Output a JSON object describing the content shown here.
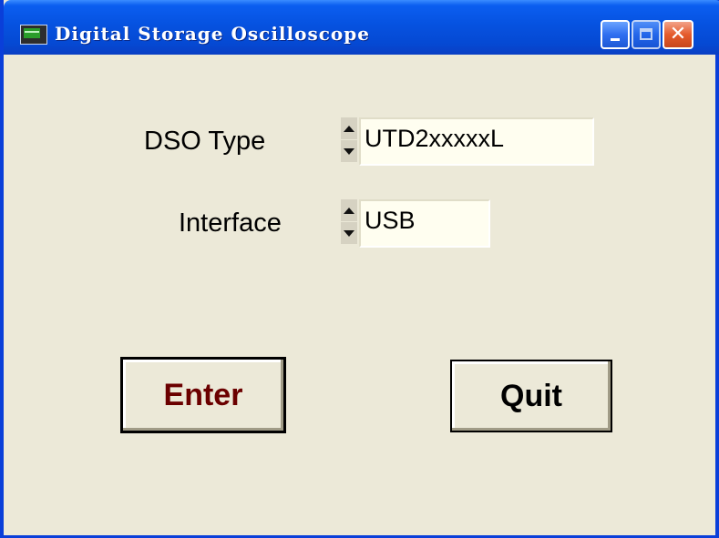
{
  "window": {
    "title": "Digital Storage Oscilloscope",
    "icon": "oscilloscope-app-icon",
    "controls": {
      "minimize_icon": "minimize-icon",
      "maximize_icon": "maximize-icon",
      "close_icon": "close-icon",
      "close_glyph": "✕"
    }
  },
  "form": {
    "dso_type": {
      "label": "DSO Type",
      "value": "UTD2xxxxxL"
    },
    "interface": {
      "label": "Interface",
      "value": "USB"
    }
  },
  "buttons": {
    "enter_label": "Enter",
    "quit_label": "Quit"
  },
  "colors": {
    "title_bar": "#0652e0",
    "background": "#ece9d8",
    "enter_text": "#6b0000",
    "close_button": "#e55b2c"
  }
}
